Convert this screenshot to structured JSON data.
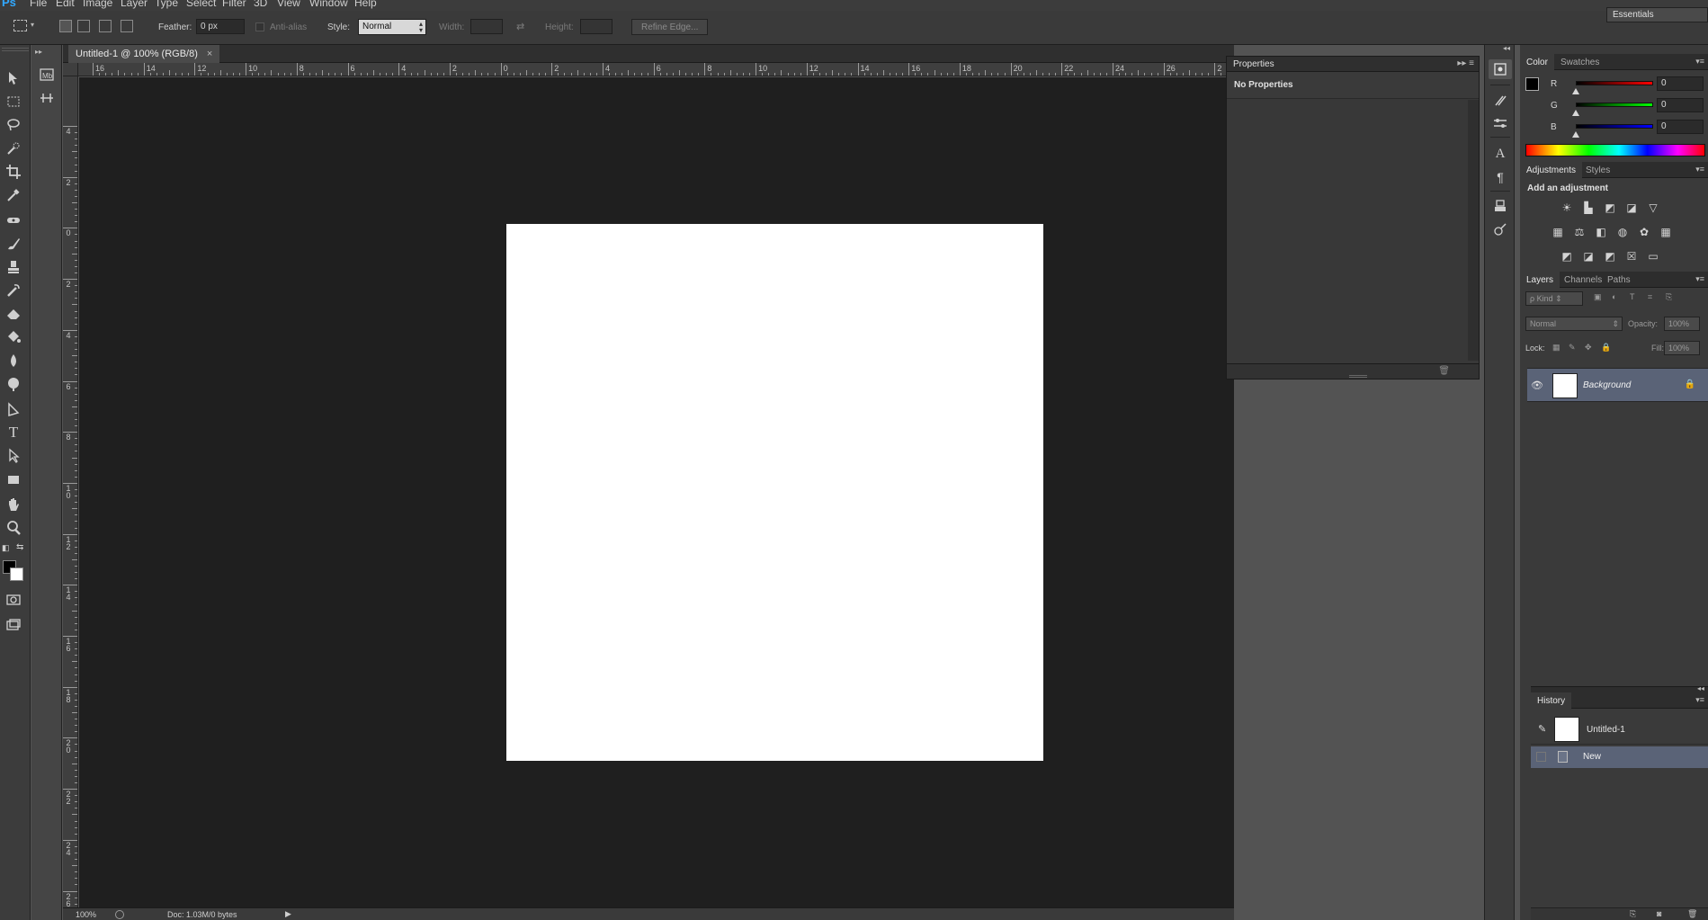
{
  "app": {
    "logo": "Ps"
  },
  "menu": [
    "File",
    "Edit",
    "Image",
    "Layer",
    "Type",
    "Select",
    "Filter",
    "3D",
    "View",
    "Window",
    "Help"
  ],
  "options": {
    "feather_label": "Feather:",
    "feather_value": "0 px",
    "antialias_label": "Anti-alias",
    "style_label": "Style:",
    "style_value": "Normal",
    "width_label": "Width:",
    "height_label": "Height:",
    "refine_edge": "Refine Edge...",
    "workspace": "Essentials"
  },
  "document": {
    "tab_title": "Untitled-1 @ 100% (RGB/8)",
    "close_glyph": "×",
    "zoom": "100%",
    "doc_info": "Doc: 1.03M/0 bytes"
  },
  "rulers": {
    "horizontal": [
      "16",
      "14",
      "12",
      "10",
      "8",
      "6",
      "4",
      "2",
      "0",
      "2",
      "4",
      "6",
      "8",
      "10",
      "12",
      "14",
      "16",
      "18",
      "20",
      "22",
      "24",
      "26",
      "2"
    ],
    "vertical": [
      "4",
      "2",
      "0",
      "2",
      "4",
      "6",
      "8",
      "10",
      "12",
      "14",
      "16",
      "18",
      "20",
      "22",
      "24",
      "26"
    ]
  },
  "properties": {
    "title": "Properties",
    "empty_message": "No Properties",
    "expand_glyph": "▸▸"
  },
  "color_panel": {
    "tabs": [
      "Color",
      "Swatches"
    ],
    "channels": [
      {
        "label": "R",
        "value": "0",
        "color": "#ff0000"
      },
      {
        "label": "G",
        "value": "0",
        "color": "#00ff00"
      },
      {
        "label": "B",
        "value": "0",
        "color": "#0000ff"
      }
    ],
    "foreground": "#000000",
    "background": "#ffffff"
  },
  "adjustments": {
    "tabs": [
      "Adjustments",
      "Styles"
    ],
    "title": "Add an adjustment",
    "icons": [
      "brightness-icon",
      "levels-icon",
      "curves-icon",
      "exposure-icon",
      "vibrance-icon",
      "hue-saturation-icon",
      "color-balance-icon",
      "black-white-icon",
      "photo-filter-icon",
      "channel-mixer-icon",
      "color-lookup-icon",
      "invert-icon",
      "posterize-icon",
      "threshold-icon",
      "selective-color-icon",
      "gradient-map-icon"
    ]
  },
  "layers": {
    "tabs": [
      "Layers",
      "Channels",
      "Paths"
    ],
    "kind_label": "ρ Kind",
    "blend_mode": "Normal",
    "opacity_label": "Opacity:",
    "opacity_value": "100%",
    "lock_label": "Lock:",
    "fill_label": "Fill:",
    "fill_value": "100%",
    "items": [
      {
        "name": "Background",
        "visible": true,
        "locked": true
      }
    ]
  },
  "history": {
    "title": "History",
    "snapshot": "Untitled-1",
    "steps": [
      "New"
    ]
  }
}
